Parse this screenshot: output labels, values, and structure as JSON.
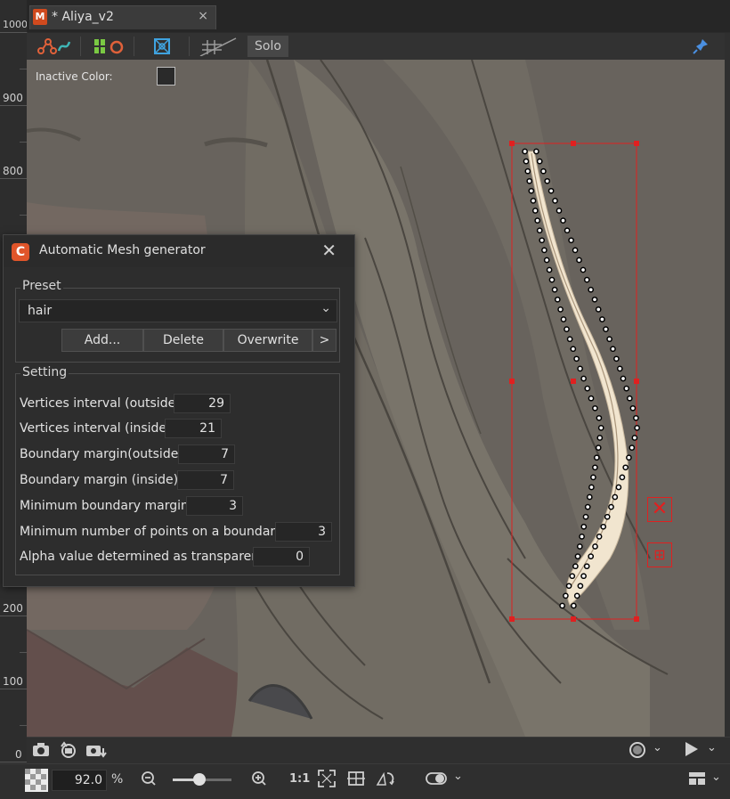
{
  "document": {
    "tab_title": "* Aliya_v2",
    "close_glyph": "×"
  },
  "ruler": {
    "labels": [
      "1000",
      "900",
      "800",
      "200",
      "100",
      "0"
    ]
  },
  "toolbar": {
    "solo_label": "Solo",
    "icons": [
      "deform-path-icon",
      "warp-icon",
      "mesh-icon",
      "grid-off-icon",
      "pin-icon"
    ]
  },
  "viewport": {
    "inactive_color_label": "Inactive Color:",
    "inactive_color_value": "#2a2a2a",
    "selection_color": "#e02020"
  },
  "dialog": {
    "title": "Automatic Mesh generator",
    "preset_group_label": "Preset",
    "preset_value": "hair",
    "buttons": {
      "add": "Add...",
      "delete": "Delete",
      "overwrite": "Overwrite",
      "more": ">"
    },
    "setting_group_label": "Setting",
    "settings": [
      {
        "label": "Vertices interval (outside)",
        "value": "29"
      },
      {
        "label": "Vertices interval (inside)",
        "value": "21"
      },
      {
        "label": "Boundary margin(outside)",
        "value": "7"
      },
      {
        "label": "Boundary margin (inside)",
        "value": "7"
      },
      {
        "label": "Minimum boundary margin",
        "value": "3"
      },
      {
        "label": "Minimum number of points on a boundary",
        "value": "3"
      },
      {
        "label": "Alpha value determined as transparent",
        "value": "0"
      }
    ]
  },
  "bottom": {
    "zoom_value": "92.0",
    "zoom_unit": "%",
    "zoom_level": 0.45,
    "one_to_one_label": "1:1"
  }
}
